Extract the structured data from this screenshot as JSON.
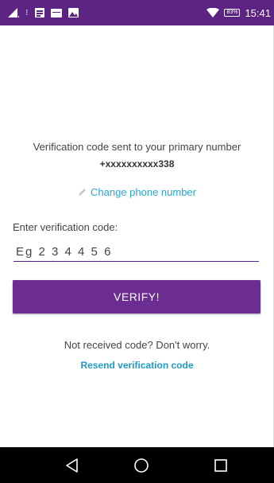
{
  "status_bar": {
    "time": "15:41",
    "battery": "83%",
    "icons": [
      "signal-icon",
      "notification-icon",
      "notification-icon",
      "keyboard-icon",
      "image-icon",
      "wifi-icon",
      "battery-icon"
    ],
    "background": "#5b2483"
  },
  "verification": {
    "sent_text": "Verification code sent to your primary number",
    "phone_number": "+xxxxxxxxxx338",
    "change_link_label": "Change phone number",
    "enter_label": "Enter verification code:",
    "code_placeholder": "Eg 2 3 4 4 5 6",
    "verify_label": "VERIFY!",
    "not_received_text": "Not received code? Don't worry.",
    "resend_label": "Resend verification code"
  },
  "colors": {
    "primary": "#6b2d92",
    "link": "#29a6cf"
  },
  "nav_bar": {
    "icons": [
      "back-icon",
      "home-icon",
      "recents-icon"
    ]
  }
}
